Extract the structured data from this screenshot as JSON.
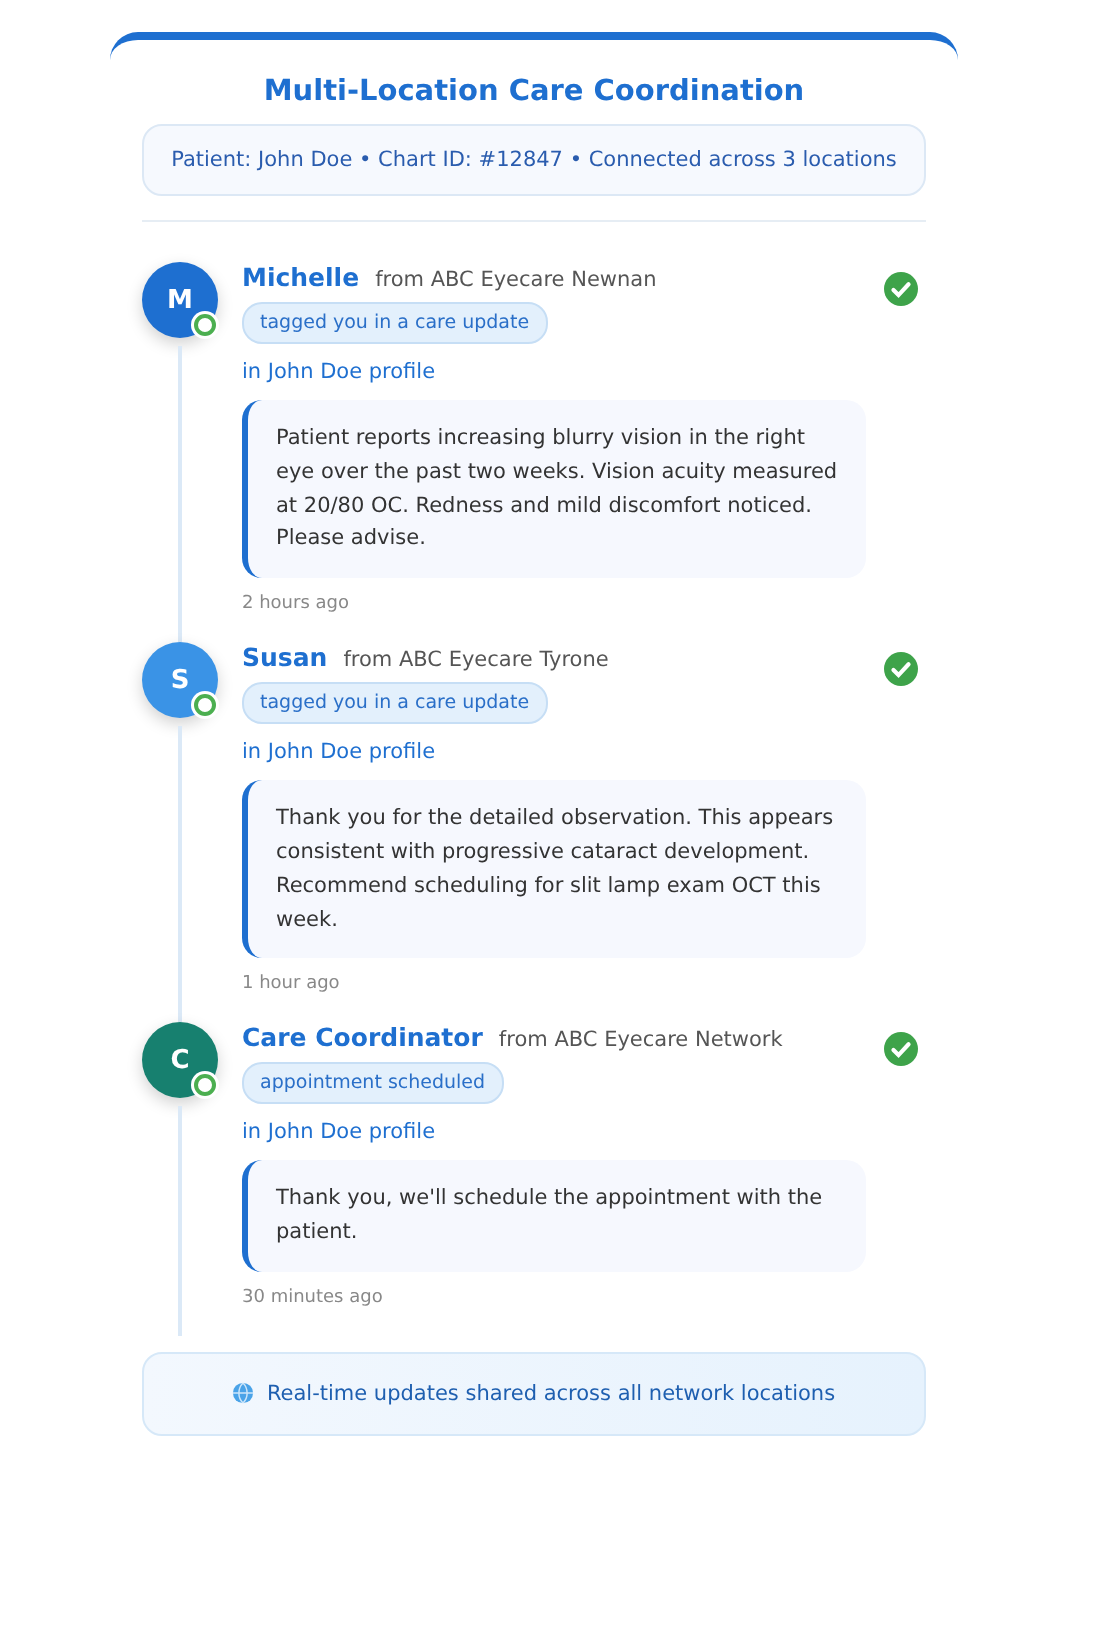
{
  "title": "Multi-Location Care Coordination",
  "patient_info": "Patient: John Doe • Chart ID: #12847 • Connected across 3 locations",
  "updates": [
    {
      "initial": "M",
      "name": "Michelle",
      "source": "from ABC Eyecare Newnan",
      "color": "#1e6fd0",
      "tag": "tagged you in a care update",
      "context": "in John Doe profile",
      "message": "Patient reports increasing blurry vision in the right eye over the past two weeks. Vision acuity measured at 20/80 OC. Redness and mild discomfort noticed. Please advise.",
      "time": "2 hours ago"
    },
    {
      "initial": "S",
      "name": "Susan",
      "source": "from ABC Eyecare Tyrone",
      "color": "#3a93e6",
      "tag": "tagged you in a care update",
      "context": "in John Doe profile",
      "message": "Thank you for the detailed observation. This appears consistent with progressive cataract development. Recommend scheduling for slit lamp exam OCT this week.",
      "time": "1 hour ago"
    },
    {
      "initial": "C",
      "name": "Care Coordinator",
      "source": "from ABC Eyecare Network",
      "color": "#17806f",
      "tag": "appointment scheduled",
      "context": "in John Doe profile",
      "message": "Thank you, we'll schedule the appointment with the patient.",
      "time": "30 minutes ago"
    }
  ],
  "footer": "Real-time updates shared across all network locations"
}
